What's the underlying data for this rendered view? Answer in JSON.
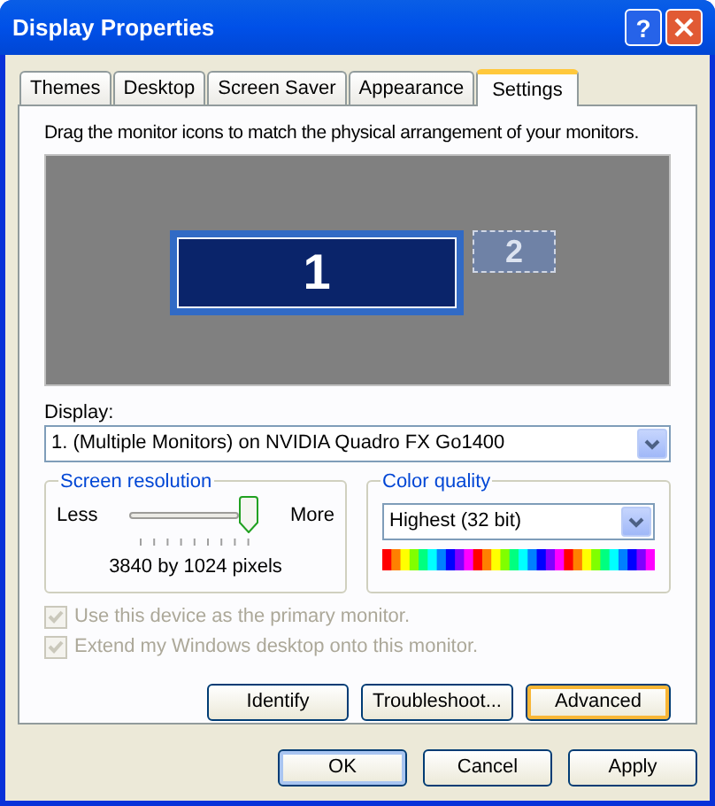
{
  "window": {
    "title": "Display Properties",
    "help_button": "?"
  },
  "tabs": [
    {
      "label": "Themes",
      "selected": false
    },
    {
      "label": "Desktop",
      "selected": false
    },
    {
      "label": "Screen Saver",
      "selected": false
    },
    {
      "label": "Appearance",
      "selected": false
    },
    {
      "label": "Settings",
      "selected": true
    }
  ],
  "instruction": "Drag the monitor icons to match the physical arrangement of your monitors.",
  "monitors": [
    {
      "label": "1",
      "selected": true
    },
    {
      "label": "2",
      "selected": false
    }
  ],
  "display": {
    "label": "Display:",
    "value": "1. (Multiple Monitors) on NVIDIA Quadro FX Go1400"
  },
  "screen_resolution": {
    "title": "Screen resolution",
    "min_label": "Less",
    "max_label": "More",
    "level": 1,
    "reading": "3840 by 1024 pixels"
  },
  "color_quality": {
    "title": "Color quality",
    "value": "Highest (32 bit)"
  },
  "checkboxes": [
    {
      "label": "Use this device as the primary monitor.",
      "checked": true,
      "disabled": true
    },
    {
      "label": "Extend my Windows desktop onto this monitor.",
      "checked": true,
      "disabled": true
    }
  ],
  "panel_buttons": [
    {
      "label": "Identify",
      "focused": false
    },
    {
      "label": "Troubleshoot...",
      "focused": false
    },
    {
      "label": "Advanced",
      "focused": true
    }
  ],
  "dialog_buttons": [
    {
      "label": "OK",
      "default": true
    },
    {
      "label": "Cancel",
      "default": false
    },
    {
      "label": "Apply",
      "default": false
    }
  ]
}
